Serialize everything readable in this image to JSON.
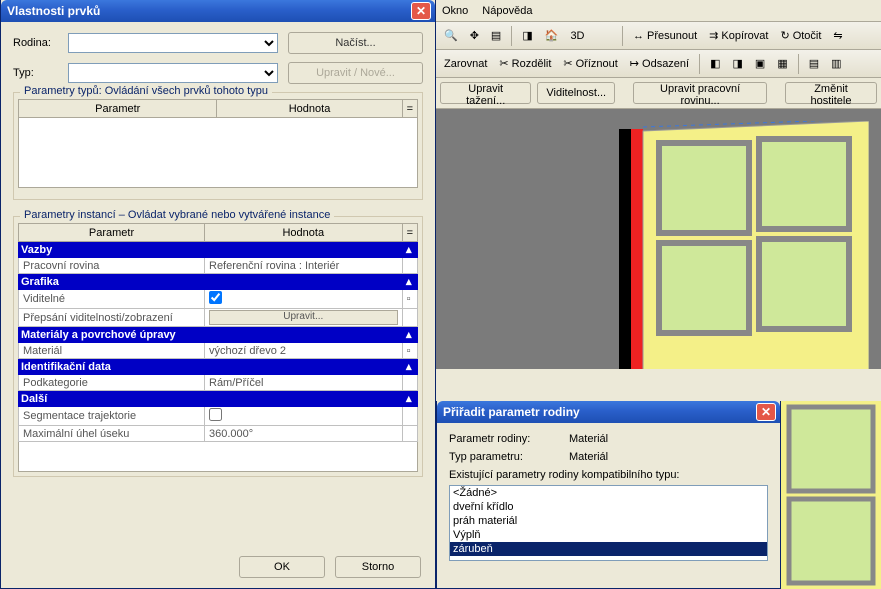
{
  "left_dialog": {
    "title": "Vlastnosti prvků",
    "family_label": "Rodina:",
    "type_label": "Typ:",
    "load_button": "Načíst...",
    "edit_new_button": "Upravit / Nové...",
    "type_params_legend": "Parametry typů: Ovládání všech prvků tohoto typu",
    "instance_params_legend": "Parametry instancí – Ovládat vybrané nebo vytvářené instance",
    "col_param": "Parametr",
    "col_value": "Hodnota",
    "col_eq": "=",
    "sections": {
      "vazby": {
        "title": "Vazby",
        "rows": [
          {
            "param": "Pracovní rovina",
            "value": "Referenční rovina : Interiér"
          }
        ]
      },
      "grafika": {
        "title": "Grafika",
        "rows": [
          {
            "param": "Viditelné",
            "checked": true
          },
          {
            "param": "Přepsání viditelnosti/zobrazení",
            "button": "Upravit..."
          }
        ]
      },
      "materialy": {
        "title": "Materiály a povrchové úpravy",
        "rows": [
          {
            "param": "Materiál",
            "value": "výchozí dřevo 2"
          }
        ]
      },
      "ident": {
        "title": "Identifikační data",
        "rows": [
          {
            "param": "Podkategorie",
            "value": "Rám/Příčel"
          }
        ]
      },
      "dalsi": {
        "title": "Další",
        "rows": [
          {
            "param": "Segmentace trajektorie",
            "checked": false
          },
          {
            "param": "Maximální úhel úseku",
            "value": "360.000°"
          }
        ]
      }
    },
    "ok": "OK",
    "cancel": "Storno"
  },
  "main": {
    "menu": {
      "okno": "Okno",
      "napoveda": "Nápověda"
    },
    "toolbar1": {
      "label_3d": "3D",
      "presunout": "Přesunout",
      "kopirovat": "Kopírovat",
      "otocit": "Otočit"
    },
    "toolbar2": {
      "zarovnat": "Zarovnat",
      "rozdelit": "Rozdělit",
      "oriznout": "Oříznout",
      "odsazeni": "Odsazení"
    },
    "actions": {
      "upravit_tazeni": "Upravit tažení...",
      "viditelnost": "Viditelnost...",
      "upravit_rovinu": "Upravit pracovní rovinu...",
      "zmenit_hostitele": "Změnit hostitele"
    }
  },
  "assign": {
    "title": "Přiřadit parametr rodiny",
    "param_label": "Parametr rodiny:",
    "param_value": "Materiál",
    "type_label": "Typ parametru:",
    "type_value": "Materiál",
    "list_label": "Existující parametry rodiny kompatibilního typu:",
    "items": [
      "<Žádné>",
      "dveřní křídlo",
      "práh materiál",
      "Výplň",
      "zárubeň"
    ],
    "selected": "zárubeň"
  }
}
